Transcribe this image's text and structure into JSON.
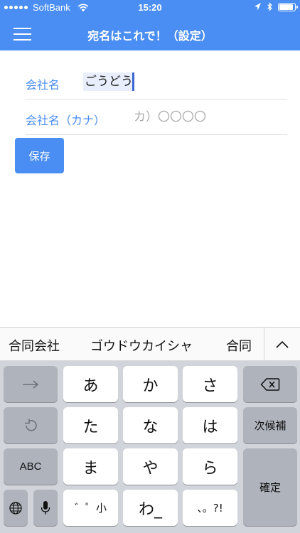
{
  "status_bar": {
    "carrier": "SoftBank",
    "time": "15:20",
    "battery_level": 0.9
  },
  "header": {
    "title": "宛名はこれで！（設定）",
    "menu_icon": "hamburger-menu-icon",
    "background": "#4a8ef3"
  },
  "form": {
    "company_name_label": "会社名",
    "company_name_value": "ごうどう",
    "company_kana_label": "会社名（カナ）",
    "company_kana_placeholder": "カ）〇〇〇〇",
    "save_label": "保存"
  },
  "candidates": {
    "items": [
      "合同会社",
      "ゴウドウカイシャ",
      "合同"
    ],
    "expand_icon": "chevron-up-icon"
  },
  "keyboard": {
    "row1": [
      "→",
      "あ",
      "か",
      "さ",
      "⌫"
    ],
    "row2": [
      "↺",
      "た",
      "な",
      "は",
      "次候補"
    ],
    "row3": [
      "ABC",
      "ま",
      "や",
      "ら",
      "確定"
    ],
    "row4": [
      "globe",
      "mic",
      "゛゜小",
      "わ_",
      "、。?!"
    ],
    "kana_keys_color": "#ffffff",
    "function_keys_color": "#aeb3bc"
  }
}
